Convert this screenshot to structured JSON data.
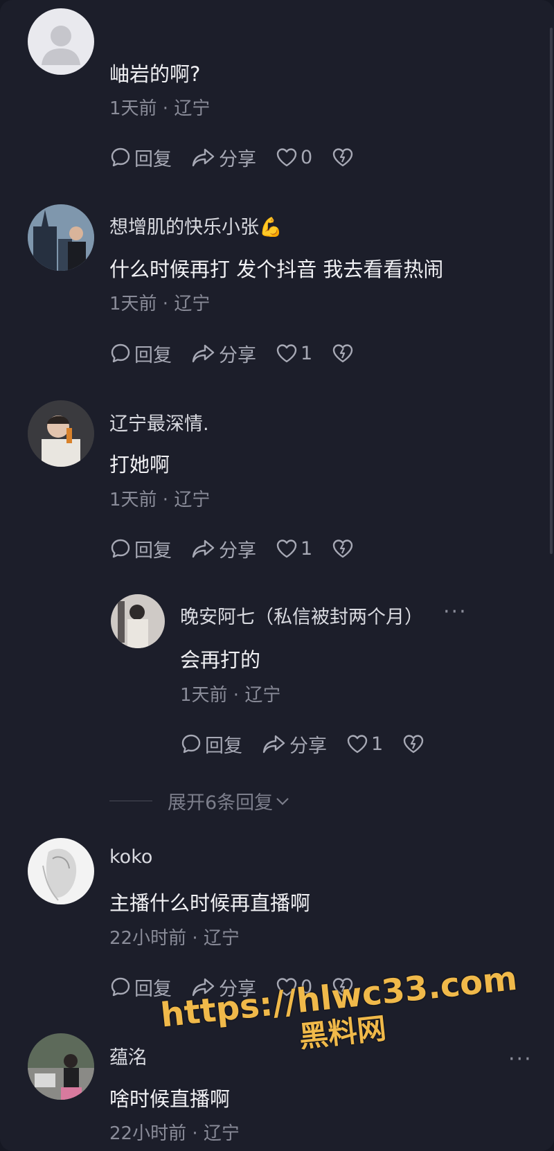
{
  "comments": [
    {
      "user": "",
      "text": "岫岩的啊?",
      "meta": "1天前 · 辽宁",
      "reply": "回复",
      "share": "分享",
      "likes": "0"
    },
    {
      "user": "想增肌的快乐小张💪",
      "text": "什么时候再打 发个抖音 我去看看热闹",
      "meta": "1天前 · 辽宁",
      "reply": "回复",
      "share": "分享",
      "likes": "1"
    },
    {
      "user": "辽宁最深情.",
      "text": "打她啊",
      "meta": "1天前 · 辽宁",
      "reply": "回复",
      "share": "分享",
      "likes": "1"
    },
    {
      "user": "晚安阿七（私信被封两个月）",
      "text": "会再打的",
      "meta": "1天前 · 辽宁",
      "reply": "回复",
      "share": "分享",
      "likes": "1",
      "more": "···"
    },
    {
      "user": "koko",
      "text": "主播什么时候再直播啊",
      "meta": "22小时前 · 辽宁",
      "reply": "回复",
      "share": "分享",
      "likes": "0"
    },
    {
      "user": "蕴洺",
      "text": "啥时候直播啊",
      "meta": "22小时前 · 辽宁",
      "more": "···"
    }
  ],
  "expand_replies": "展开6条回复",
  "watermark": {
    "url": "https://hlwc33.com",
    "name": "黑料网"
  },
  "colors": {
    "background": "#1c1e2a",
    "text": "#f1f1f4",
    "meta": "#8a8c99",
    "watermark": "#f0b94a"
  }
}
